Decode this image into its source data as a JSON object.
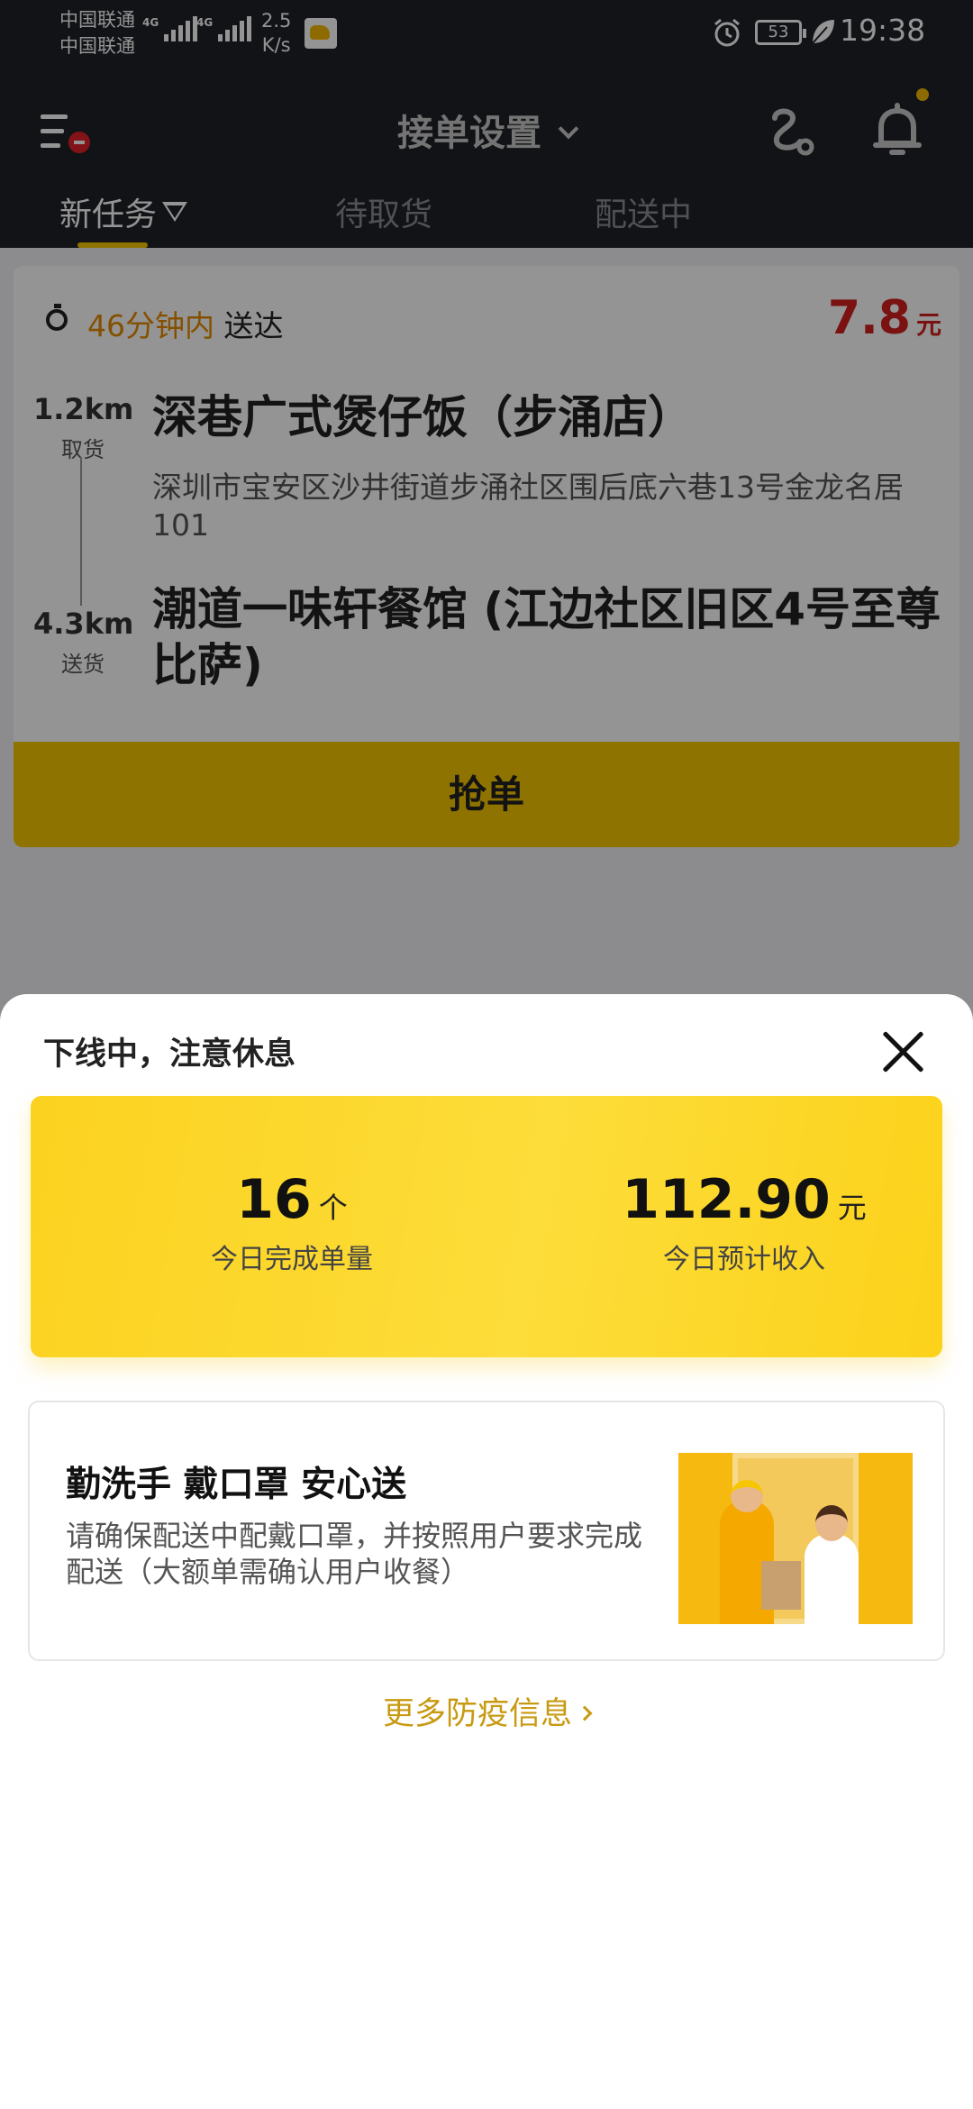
{
  "status_bar": {
    "carrier_1": "中国联通",
    "carrier_2": "中国联通",
    "network_1": "4G",
    "network_2": "4G",
    "speed_value": "2.5",
    "speed_unit": "K/s",
    "battery": "53",
    "time": "19:38"
  },
  "header": {
    "title": "接单设置",
    "tabs": [
      {
        "label": "新任务"
      },
      {
        "label": "待取货"
      },
      {
        "label": "配送中"
      }
    ]
  },
  "order": {
    "eta_highlight": "46分钟内",
    "eta_suffix": " 送达",
    "price": "7.8",
    "price_unit": "元",
    "pickup": {
      "distance": "1.2km",
      "label": "取货",
      "name": "深巷广式煲仔饭（步涌店）",
      "address": "深圳市宝安区沙井街道步涌社区围后底六巷13号金龙名居101"
    },
    "dropoff": {
      "distance": "4.3km",
      "label": "送货",
      "name": "潮道一味轩餐馆 (江边社区旧区4号至尊比萨)"
    },
    "grab_label": "抢单"
  },
  "sheet": {
    "title": "下线中，注意休息",
    "stats": [
      {
        "value": "16",
        "unit": "个",
        "label": "今日完成单量"
      },
      {
        "value": "112.90",
        "unit": "元",
        "label": "今日预计收入"
      }
    ],
    "notice": {
      "title": "勤洗手 戴口罩 安心送",
      "body": "请确保配送中配戴口罩，并按照用户要求完成配送（大额单需确认用户收餐）"
    },
    "more_link": "更多防疫信息"
  },
  "colors": {
    "header_bg": "#1f2128",
    "accent_yellow": "#f7c600",
    "price_red": "#d21f1f",
    "eta_orange": "#e38a00",
    "link_gold": "#c89a12"
  }
}
